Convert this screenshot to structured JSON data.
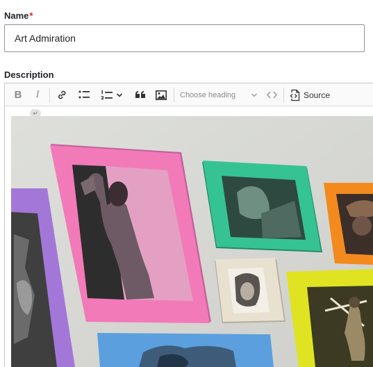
{
  "name_field": {
    "label": "Name",
    "required_marker": "*",
    "value": "Art Admiration"
  },
  "description_field": {
    "label": "Description"
  },
  "toolbar": {
    "bold_label": "B",
    "italic_label": "I",
    "heading_placeholder": "Choose heading",
    "source_label": "Source",
    "icons": [
      "bold-icon",
      "italic-icon",
      "link-icon",
      "bulleted-list-icon",
      "numbered-list-icon",
      "chevron-down-icon",
      "blockquote-icon",
      "image-icon",
      "chevron-down-icon",
      "code-icon",
      "source-icon"
    ]
  },
  "content": {
    "return_marker": "↵",
    "image_description_colors": {
      "wall": "#d8d9d5",
      "pink_frame": "#f27ab8",
      "green_frame": "#35c393",
      "orange_frame": "#f38a1e",
      "purple_frame": "#a377d8",
      "yellow_frame": "#dfe322",
      "blue_frame": "#5b9fde",
      "cream_frame": "#e9e1d0"
    }
  }
}
